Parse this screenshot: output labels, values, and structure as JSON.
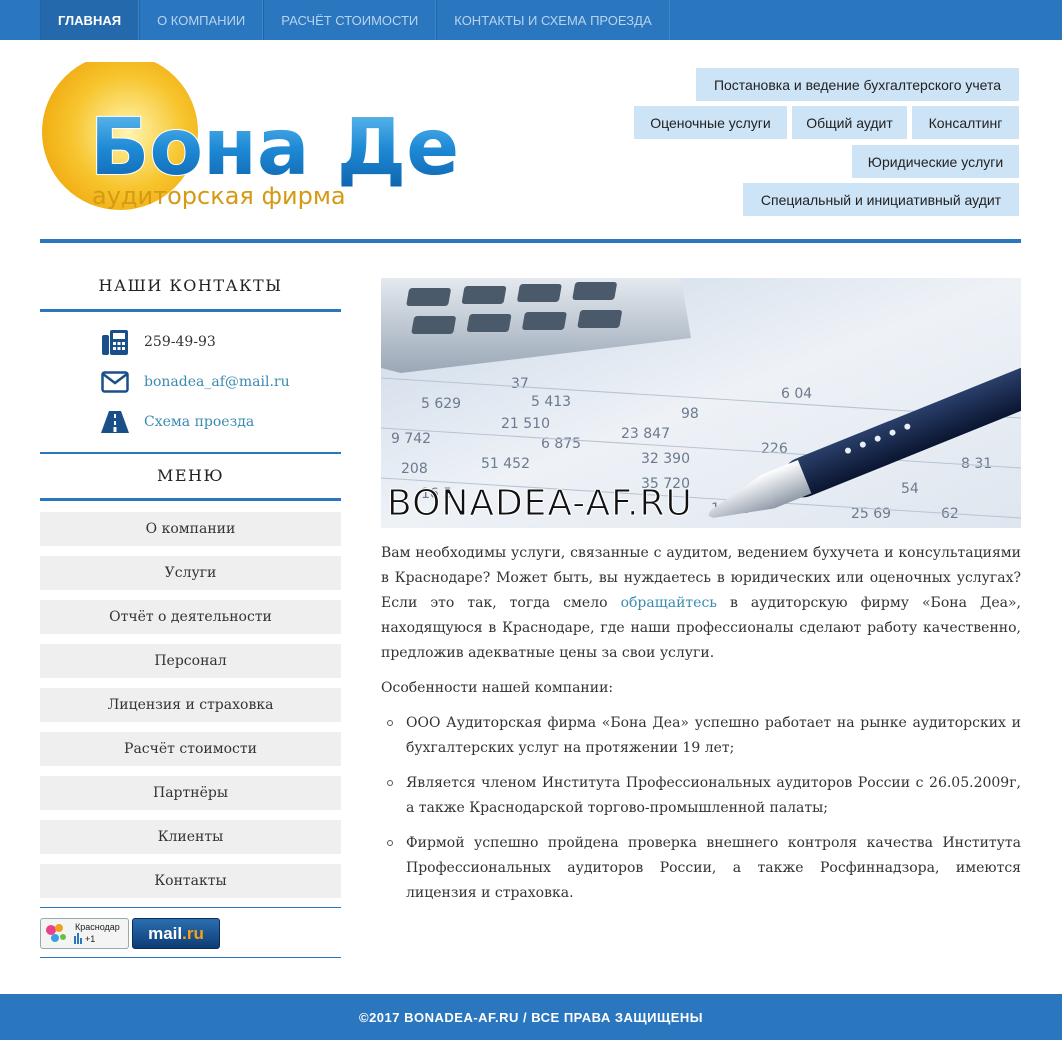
{
  "topnav": {
    "items": [
      "ГЛАВНАЯ",
      "О КОМПАНИИ",
      "РАСЧЁТ СТОИМОСТИ",
      "КОНТАКТЫ И СХЕМА ПРОЕЗДА"
    ],
    "active": "ГЛАВНАЯ"
  },
  "logo": {
    "name": "Бона Деа",
    "subtitle": "аудиторская фирма"
  },
  "services": [
    "Постановка и ведение бухгалтерского учета",
    "Оценочные услуги",
    "Общий аудит",
    "Консалтинг",
    "Юридические услуги",
    "Специальный и инициативный аудит"
  ],
  "sidebar": {
    "contacts_title": "НАШИ КОНТАКТЫ",
    "phone": "259-49-93",
    "email": "bonadea_af@mail.ru",
    "directions": "Схема проезда",
    "menu_title": "МЕНЮ",
    "menu": [
      "О компании",
      "Услуги",
      "Отчёт о деятельности",
      "Персонал",
      "Лицензия и страховка",
      "Расчёт стоимости",
      "Партнёры",
      "Клиенты",
      "Контакты"
    ],
    "badge_krasnodar": "Краснодар",
    "badge_krasnodar_count": "+1",
    "badge_mail_a": "mail",
    "badge_mail_b": ".ru"
  },
  "hero": {
    "caption": "BONADEA-AF.RU"
  },
  "content": {
    "intro_before": "Вам необходимы услуги, связанные с аудитом, ведением бухучета и консультациями в Краснодаре? Может быть, вы нуждаетесь в юридических или оценочных услугах? Если это так, тогда смело ",
    "intro_link": "обращайтесь",
    "intro_after": " в аудиторскую фирму «Бона Деа», находящуюся в Краснодаре, где наши профессионалы сделают работу качественно, предложив адекватные цены за свои услуги.",
    "features_title": "Особенности нашей компании:",
    "features": [
      "ООО Аудиторская фирма «Бона Деа» успешно работает на рынке аудиторских и бухгалтерских услуг на протяжении 19 лет;",
      "Является членом Института Профессиональных аудиторов России с 26.05.2009г, а также Краснодарской торгово-промышленной палаты;",
      "Фирмой успешно пройдена проверка внешнего контроля качества Института Профессиональных аудиторов России, а также Росфиннадзора, имеются лицензия и страховка."
    ]
  },
  "footer": {
    "text": "©2017 BONADEA-AF.RU / ВСЕ ПРАВА ЗАЩИЩЕНЫ"
  },
  "colors": {
    "primary": "#2a77c0",
    "service_bg": "#cde3f6",
    "menu_bg": "#efefef",
    "link": "#3a8bb0"
  }
}
